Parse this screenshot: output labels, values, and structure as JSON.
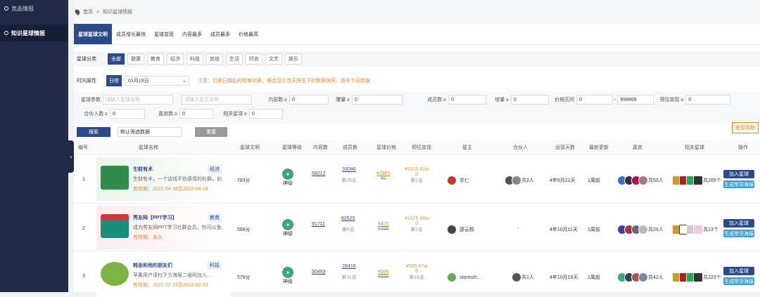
{
  "sidebar": {
    "items": [
      {
        "label": "竞品情报"
      },
      {
        "label": "知识星球情报"
      }
    ]
  },
  "breadcrumb": {
    "home": "首页",
    "sep": ">",
    "current": "知识星球情报"
  },
  "tabs": [
    "星球星球文明",
    "成员增长最快",
    "星球变现",
    "内容最多",
    "成员最多",
    "价格最高"
  ],
  "category": {
    "label": "星球分类",
    "options": [
      "全部",
      "健康",
      "教育",
      "经济",
      "科技",
      "其他",
      "生活",
      "时尚",
      "文艺",
      "娱乐"
    ]
  },
  "time": {
    "label": "时间属性",
    "day": "日榜",
    "date": "01月19日",
    "note": "注意：切换日期后的榜单列表，将会显示当天爬虫下的数据快照，而非今日数据"
  },
  "filters": {
    "planet_params": "星球参数",
    "name_ph": "请输入星球名称",
    "owner_ph": "请输入星主名称",
    "content_label": "内容数 ≥",
    "content_val": "0",
    "exposure_label": "曝量 ≥",
    "exposure_val": "0",
    "members_label": "成员数 ≥",
    "members_val": "0",
    "growth_label": "增量 ≥",
    "growth_val": "0",
    "price_label": "价格区间",
    "price_min": "0",
    "price_dash": "-",
    "price_max": "999999",
    "revenue_label": "预估变现 ≥",
    "revenue_val": "0",
    "partners_label": "合伙人数 ≥",
    "partners_val": "0",
    "guests_label": "嘉宾数 ≥",
    "guests_val": "0",
    "related_label": "相关星球 ≥",
    "related_val": "0"
  },
  "actions": {
    "search": "搜索",
    "sort": "默认筛选数据",
    "reset": "重置",
    "guide": "使用帮助"
  },
  "columns": [
    "编号",
    "星球名称",
    "星球文明",
    "星球等级",
    "内容数",
    "成员数",
    "星球价格",
    "预估变现",
    "星主",
    "合伙人",
    "运营天数",
    "最新更新",
    "嘉宾",
    "相关星球",
    "操作"
  ],
  "rows": [
    {
      "no": "1",
      "name": "生财有术",
      "tag": "经济",
      "desc": "生财有术，一个谈钱不伤感情的社群。创...",
      "valid": "有效期：2021-04-18至2022-04-18",
      "score": "783分",
      "level": "神级",
      "content": "58212",
      "content_sub": "-",
      "members": "33046",
      "members_sub": "-",
      "members_rank": "第26名",
      "price": "¥2865",
      "price_old": "¥0",
      "revenue": "¥6315.61w",
      "revenue_sub": "0",
      "revenue_rank": "第1名",
      "owner": "亦仁",
      "partners": "共2人",
      "days": "4年9月22天",
      "update": "1周前",
      "guests": "共50人",
      "related": "共265个",
      "btn1": "加入星球",
      "btn2": "生成带货海报",
      "thumb_color": "#2f8c4a"
    },
    {
      "no": "2",
      "name": "秀友网【PPT学习】",
      "tag": "教育",
      "desc": "成为秀友网PPT学习社群会员，你可以免...",
      "valid": "有效期：永久",
      "score": "586分",
      "level": "神级",
      "content": "91711",
      "content_sub": "-",
      "members": "62525",
      "members_sub": "-",
      "members_rank": "第8名",
      "price": "¥420",
      "price_old": "¥499",
      "revenue": "¥1626.48w",
      "revenue_sub": "0",
      "revenue_rank": "第2名",
      "owner": "邵云蛟",
      "partners": "-",
      "days": "4年10月11天",
      "update": "1周前",
      "guests": "共29人",
      "related": "共13个",
      "btn1": "加入星球",
      "btn2": "生成带货海报",
      "thumb_color": "#1a8f7c"
    },
    {
      "no": "3",
      "name": "韩张和他的朋友们",
      "tag": "科技",
      "desc": "苹果用户请扫下方海报二维码加入...",
      "valid": "有效期：2021-02-23至2022-02-23",
      "score": "579分",
      "level": "神级",
      "content": "50493",
      "content_sub": "-",
      "members": "28416",
      "members_sub": "-",
      "members_rank": "第31名",
      "price": "¥599",
      "price_old": "¥599",
      "revenue": "¥585.67w",
      "revenue_sub": "0",
      "revenue_rank": "第16名",
      "owner": "stormzh...",
      "partners": "共1人",
      "days": "4年10月16天",
      "update": "1周前",
      "guests": "共42人",
      "related": "共223个",
      "btn1": "加入星球",
      "btn2": "生成带货海报",
      "thumb_color": "#7cb342"
    }
  ]
}
